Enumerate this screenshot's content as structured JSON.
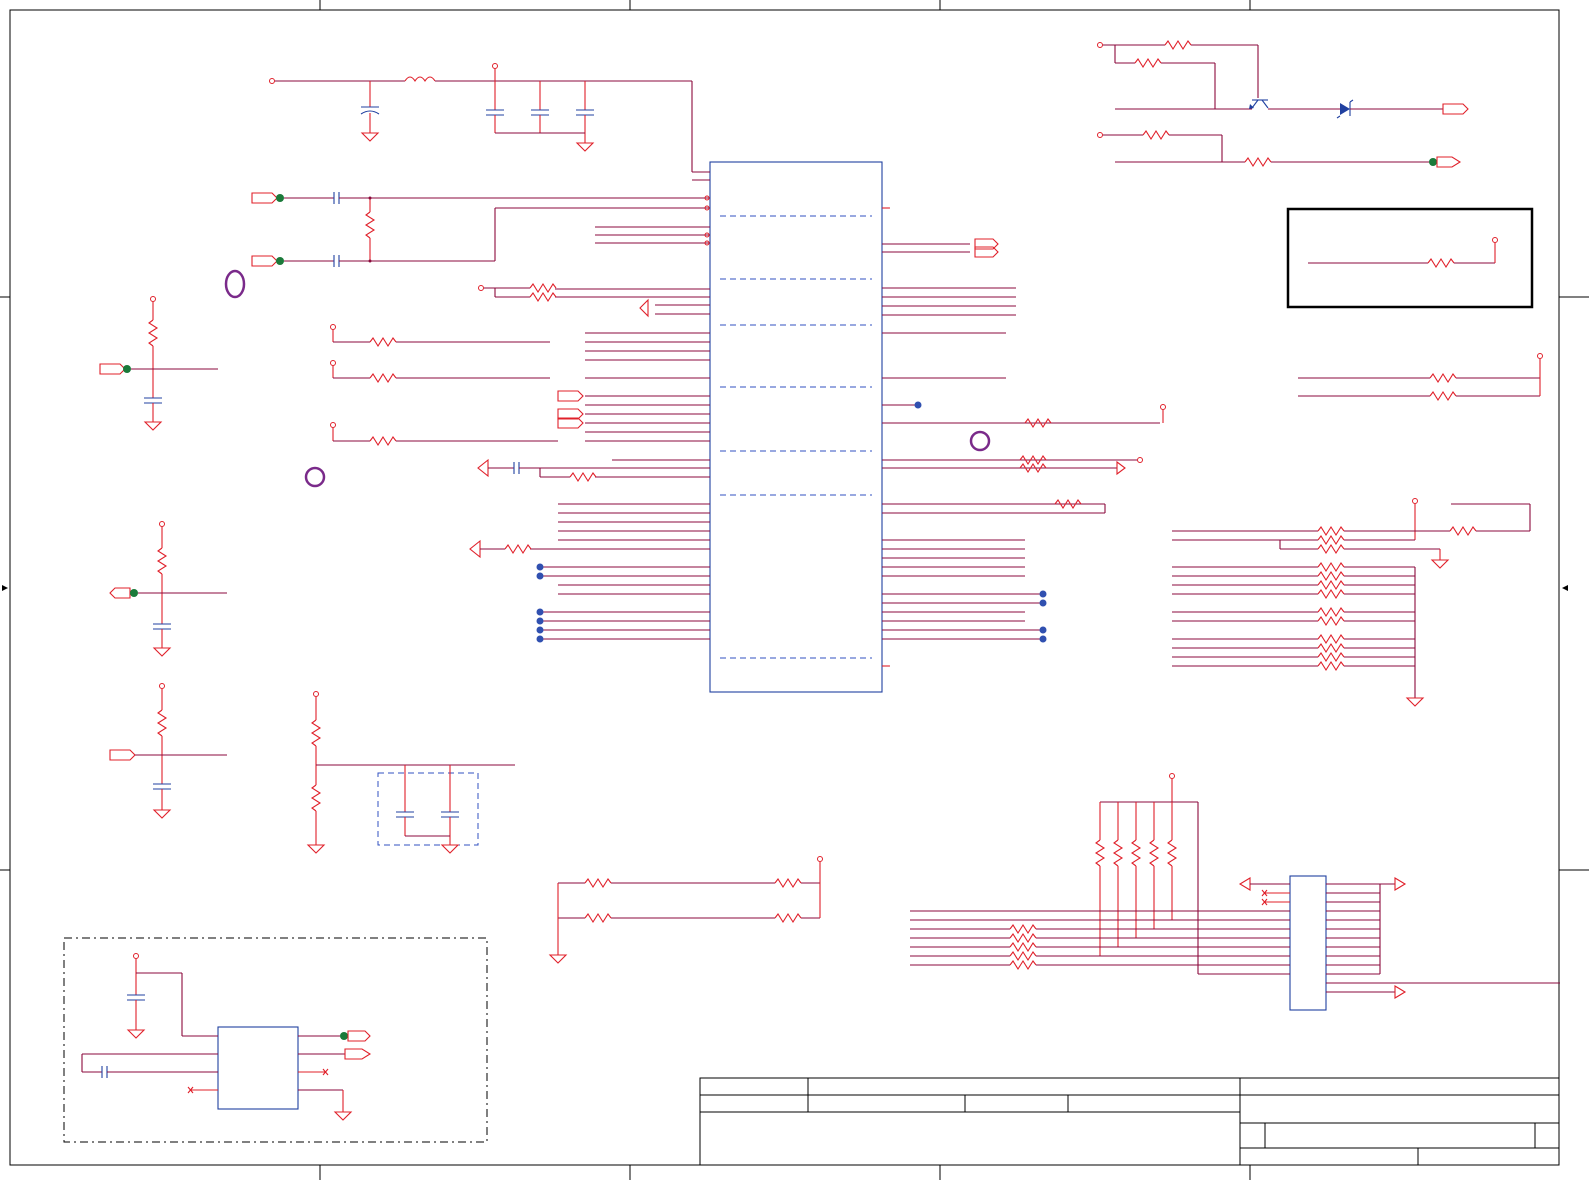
{
  "document": {
    "type": "electrical-schematic",
    "colors": {
      "wire": "#8b0a3c",
      "pin": "#e0202a",
      "component": "#2040a0",
      "test_point": "#1a7a3a",
      "no_connect_marker": "#7a2a8a",
      "frame": "#000000"
    }
  },
  "title_block": {
    "cells": [
      "",
      "",
      "",
      "",
      "",
      "",
      "",
      "",
      ""
    ]
  }
}
